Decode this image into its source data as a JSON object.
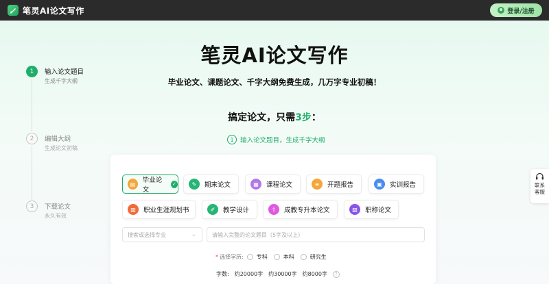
{
  "app": {
    "logo_text": "笔灵AI论文写作",
    "login_label": "登录/注册"
  },
  "steps": [
    {
      "num": "1",
      "title": "输入论文题目",
      "subtitle": "生成千字大纲"
    },
    {
      "num": "2",
      "title": "编辑大纲",
      "subtitle": "生成论文初稿"
    },
    {
      "num": "3",
      "title": "下载论文",
      "subtitle": "永久有效"
    }
  ],
  "hero": {
    "title": "笔灵AI论文写作",
    "subtitle": "毕业论文、课题论文、千字大纲免费生成，几万字专业初稿！"
  },
  "hint": {
    "prefix": "搞定论文，只需",
    "highlight": "3步",
    "suffix": "：",
    "step_num": "1",
    "step_text": "输入论文题目，生成千字大纲"
  },
  "types": [
    {
      "label": "毕业论文",
      "icon": "graduation-icon",
      "color": "#f4a63a",
      "selected": true
    },
    {
      "label": "期末论文",
      "icon": "edit-icon",
      "color": "#26b574",
      "selected": false
    },
    {
      "label": "课程论文",
      "icon": "course-icon",
      "color": "#b377e6",
      "selected": false
    },
    {
      "label": "开题报告",
      "icon": "report-icon",
      "color": "#f4a63a",
      "selected": false
    },
    {
      "label": "实训报告",
      "icon": "training-icon",
      "color": "#4a8cf0",
      "selected": false
    },
    {
      "label": "职业生涯规划书",
      "icon": "career-icon",
      "color": "#f06b3a",
      "selected": false
    },
    {
      "label": "教学设计",
      "icon": "teaching-icon",
      "color": "#26b574",
      "selected": false
    },
    {
      "label": "成教专升本论文",
      "icon": "upgrade-icon",
      "color": "#e05adf",
      "selected": false
    },
    {
      "label": "职称论文",
      "icon": "title-icon",
      "color": "#8a55e8",
      "selected": false
    }
  ],
  "form": {
    "major_placeholder": "搜索或选择专业",
    "title_placeholder": "请输入完整的论文题目（5字及以上）",
    "edu_label": "选择学历:",
    "edu_options": [
      "专科",
      "本科",
      "研究生"
    ],
    "words_label": "字数:",
    "word_options": [
      "约20000字",
      "约30000字",
      "约8000字"
    ]
  },
  "contact": {
    "label": "联系客服"
  }
}
